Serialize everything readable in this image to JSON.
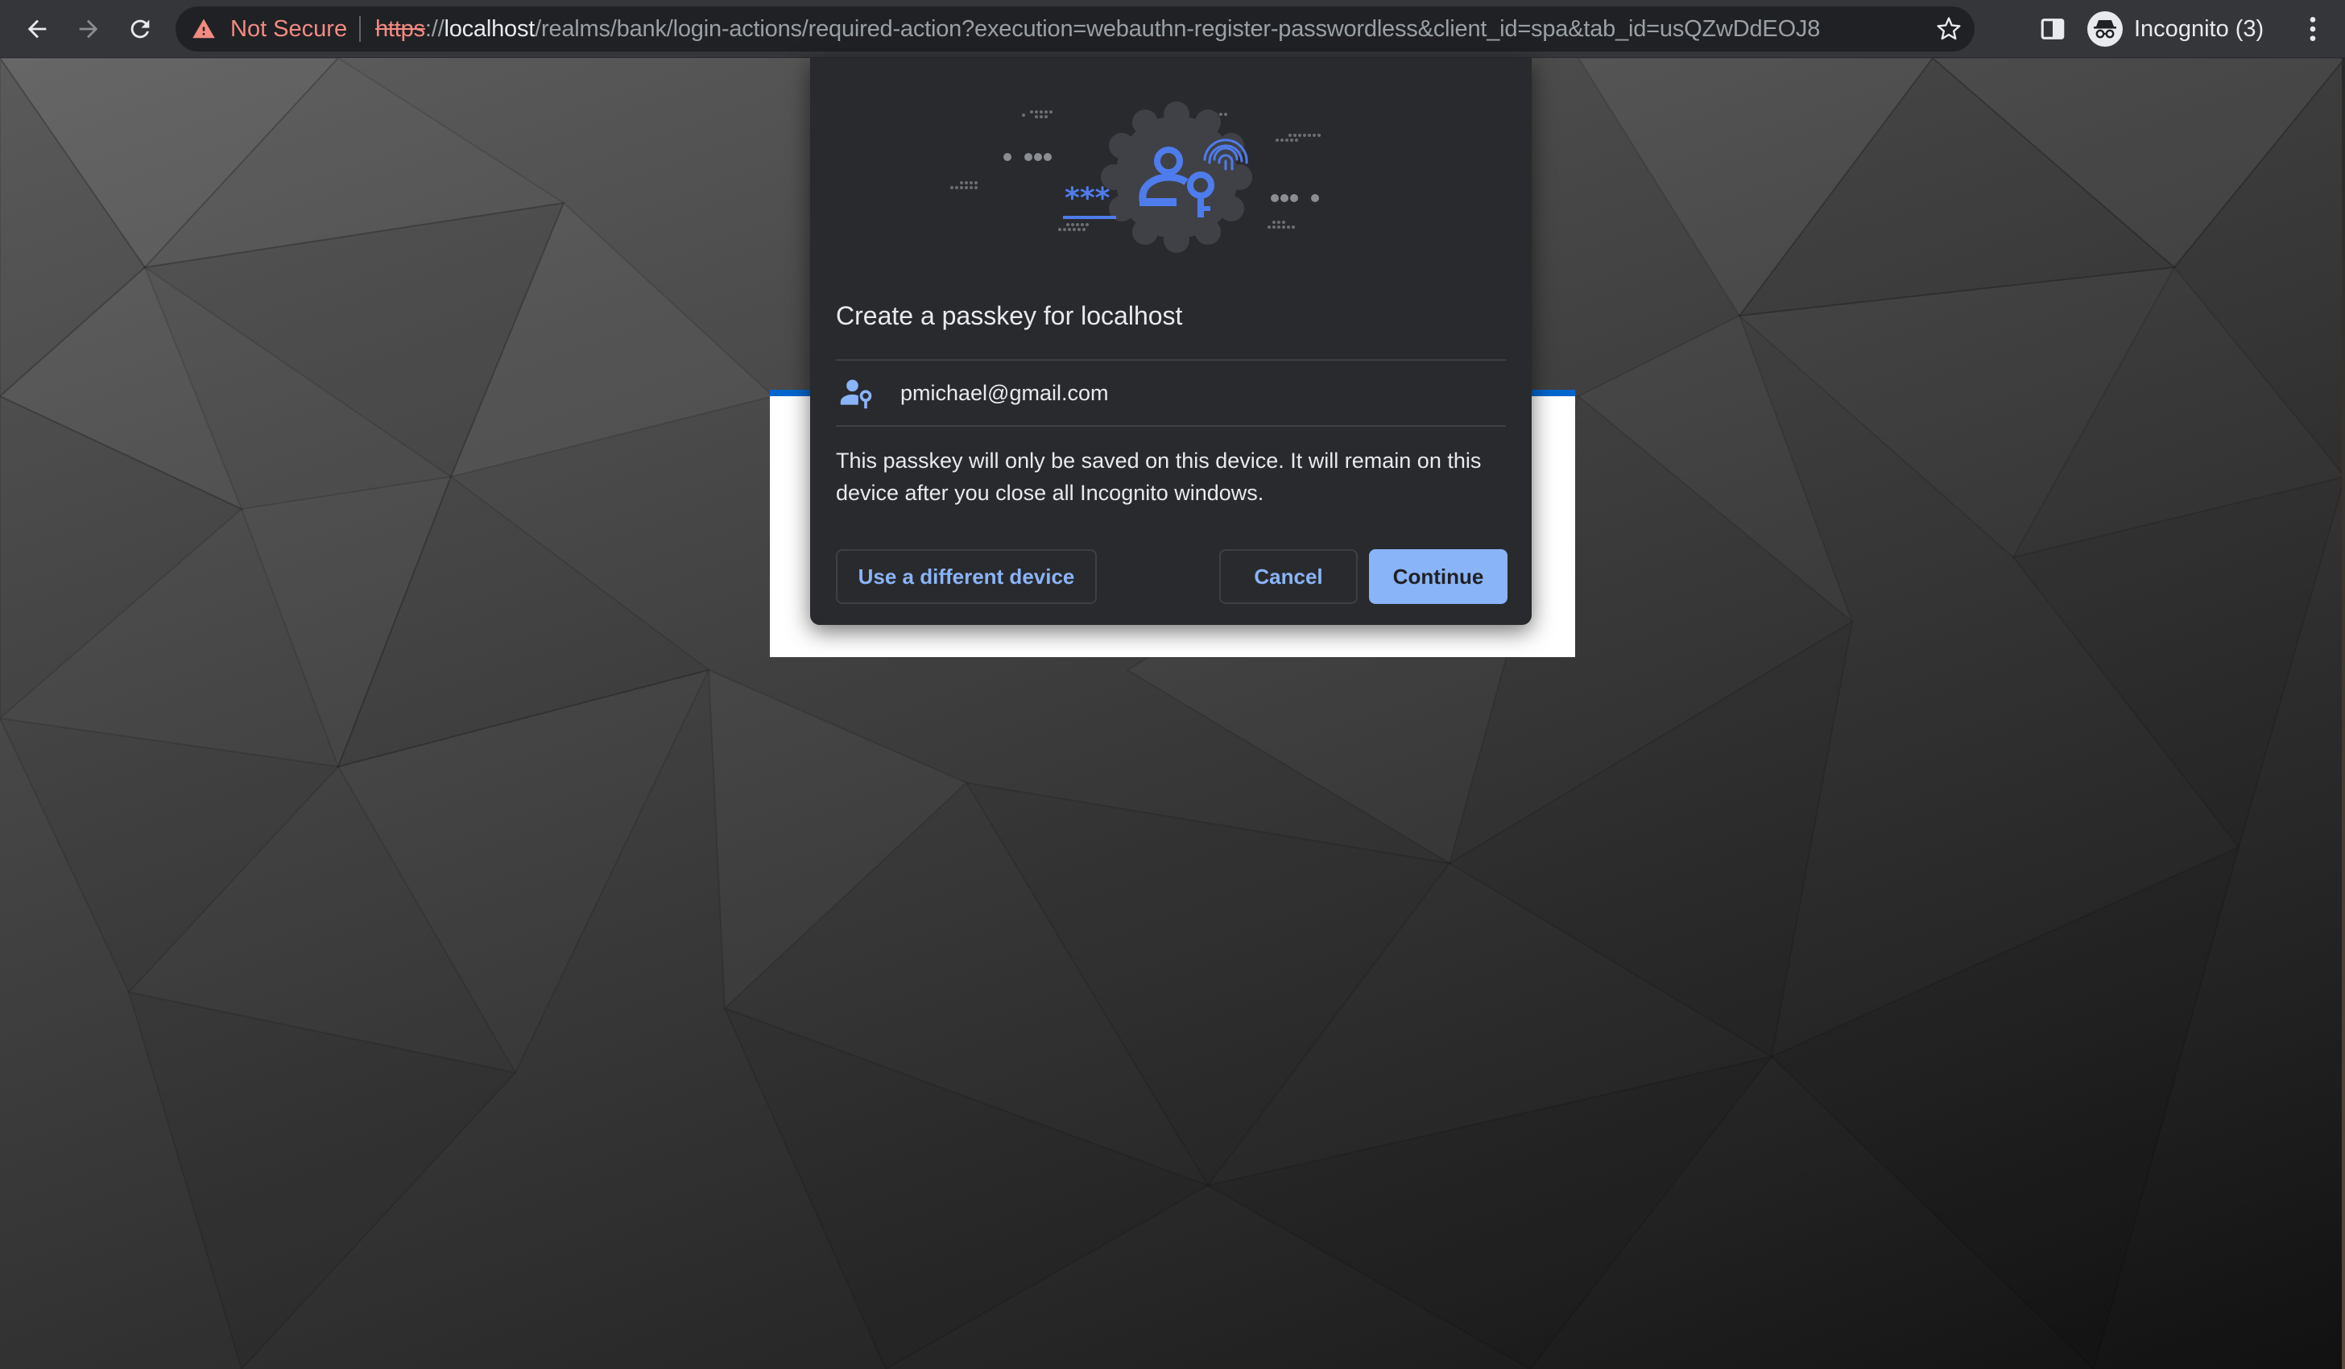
{
  "browser": {
    "security_label": "Not Secure",
    "url": {
      "scheme": "https",
      "separator": "://",
      "host": "localhost",
      "path": "/realms/bank/login-actions/required-action?execution=webauthn-register-passwordless&client_id=spa&tab_id=usQZwDdEOJ8"
    },
    "profile_label": "Incognito (3)",
    "icons": {
      "back": "back-arrow-icon",
      "forward": "forward-arrow-icon",
      "reload": "reload-icon",
      "warning": "warning-icon",
      "bookmark": "star-icon",
      "side_panel": "side-panel-icon",
      "incognito": "incognito-icon",
      "menu": "kebab-menu-icon"
    }
  },
  "dialog": {
    "title": "Create a passkey for localhost",
    "account_email": "pmichael@gmail.com",
    "description": "This passkey will only be saved on this device. It will remain on this device after you close all Incognito windows.",
    "buttons": {
      "alt_device": "Use a different device",
      "cancel": "Cancel",
      "continue": "Continue"
    }
  },
  "colors": {
    "toolbar_bg": "#35363a",
    "omnibox_bg": "#202124",
    "dialog_bg": "#292a2d",
    "accent": "#8ab4f8",
    "warning": "#f28b82",
    "illustration_blue": "#4f7cec",
    "card_accent": "#0066cc"
  }
}
